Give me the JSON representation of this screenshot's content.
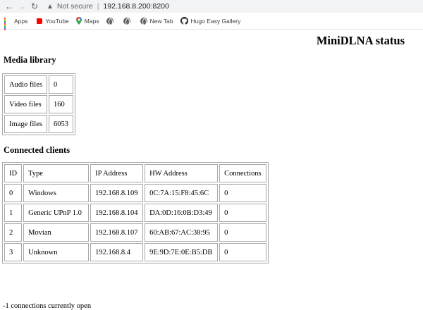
{
  "browser": {
    "security_label": "Not secure",
    "url": "192.168.8.200:8200",
    "bookmarks": [
      {
        "label": "Apps",
        "icon": "apps-grid-icon"
      },
      {
        "label": "YouTube",
        "icon": "youtube-icon"
      },
      {
        "label": "Maps",
        "icon": "maps-pin-icon"
      },
      {
        "label": "",
        "icon": "globe-icon"
      },
      {
        "label": "",
        "icon": "globe-icon"
      },
      {
        "label": "New Tab",
        "icon": "globe-icon"
      },
      {
        "label": "Hugo Easy Gallery",
        "icon": "github-icon"
      }
    ]
  },
  "page": {
    "title": "MiniDLNA status",
    "media_heading": "Media library",
    "media": [
      {
        "label": "Audio files",
        "value": "0"
      },
      {
        "label": "Video files",
        "value": "160"
      },
      {
        "label": "Image files",
        "value": "6053"
      }
    ],
    "clients_heading": "Connected clients",
    "clients_headers": [
      "ID",
      "Type",
      "IP Address",
      "HW Address",
      "Connections"
    ],
    "clients": [
      [
        "0",
        "Windows",
        "192.168.8.109",
        "0C:7A:15:F8:45:6C",
        "0"
      ],
      [
        "1",
        "Generic UPnP 1.0",
        "192.168.8.104",
        "DA:0D:16:0B:D3:49",
        "0"
      ],
      [
        "2",
        "Movian",
        "192.168.8.107",
        "60:AB:67:AC:38:95",
        "0"
      ],
      [
        "3",
        "Unknown",
        "192.168.8.4",
        "9E:9D:7E:0E:B5:DB",
        "0"
      ]
    ],
    "footer": "-1 connections currently open"
  }
}
